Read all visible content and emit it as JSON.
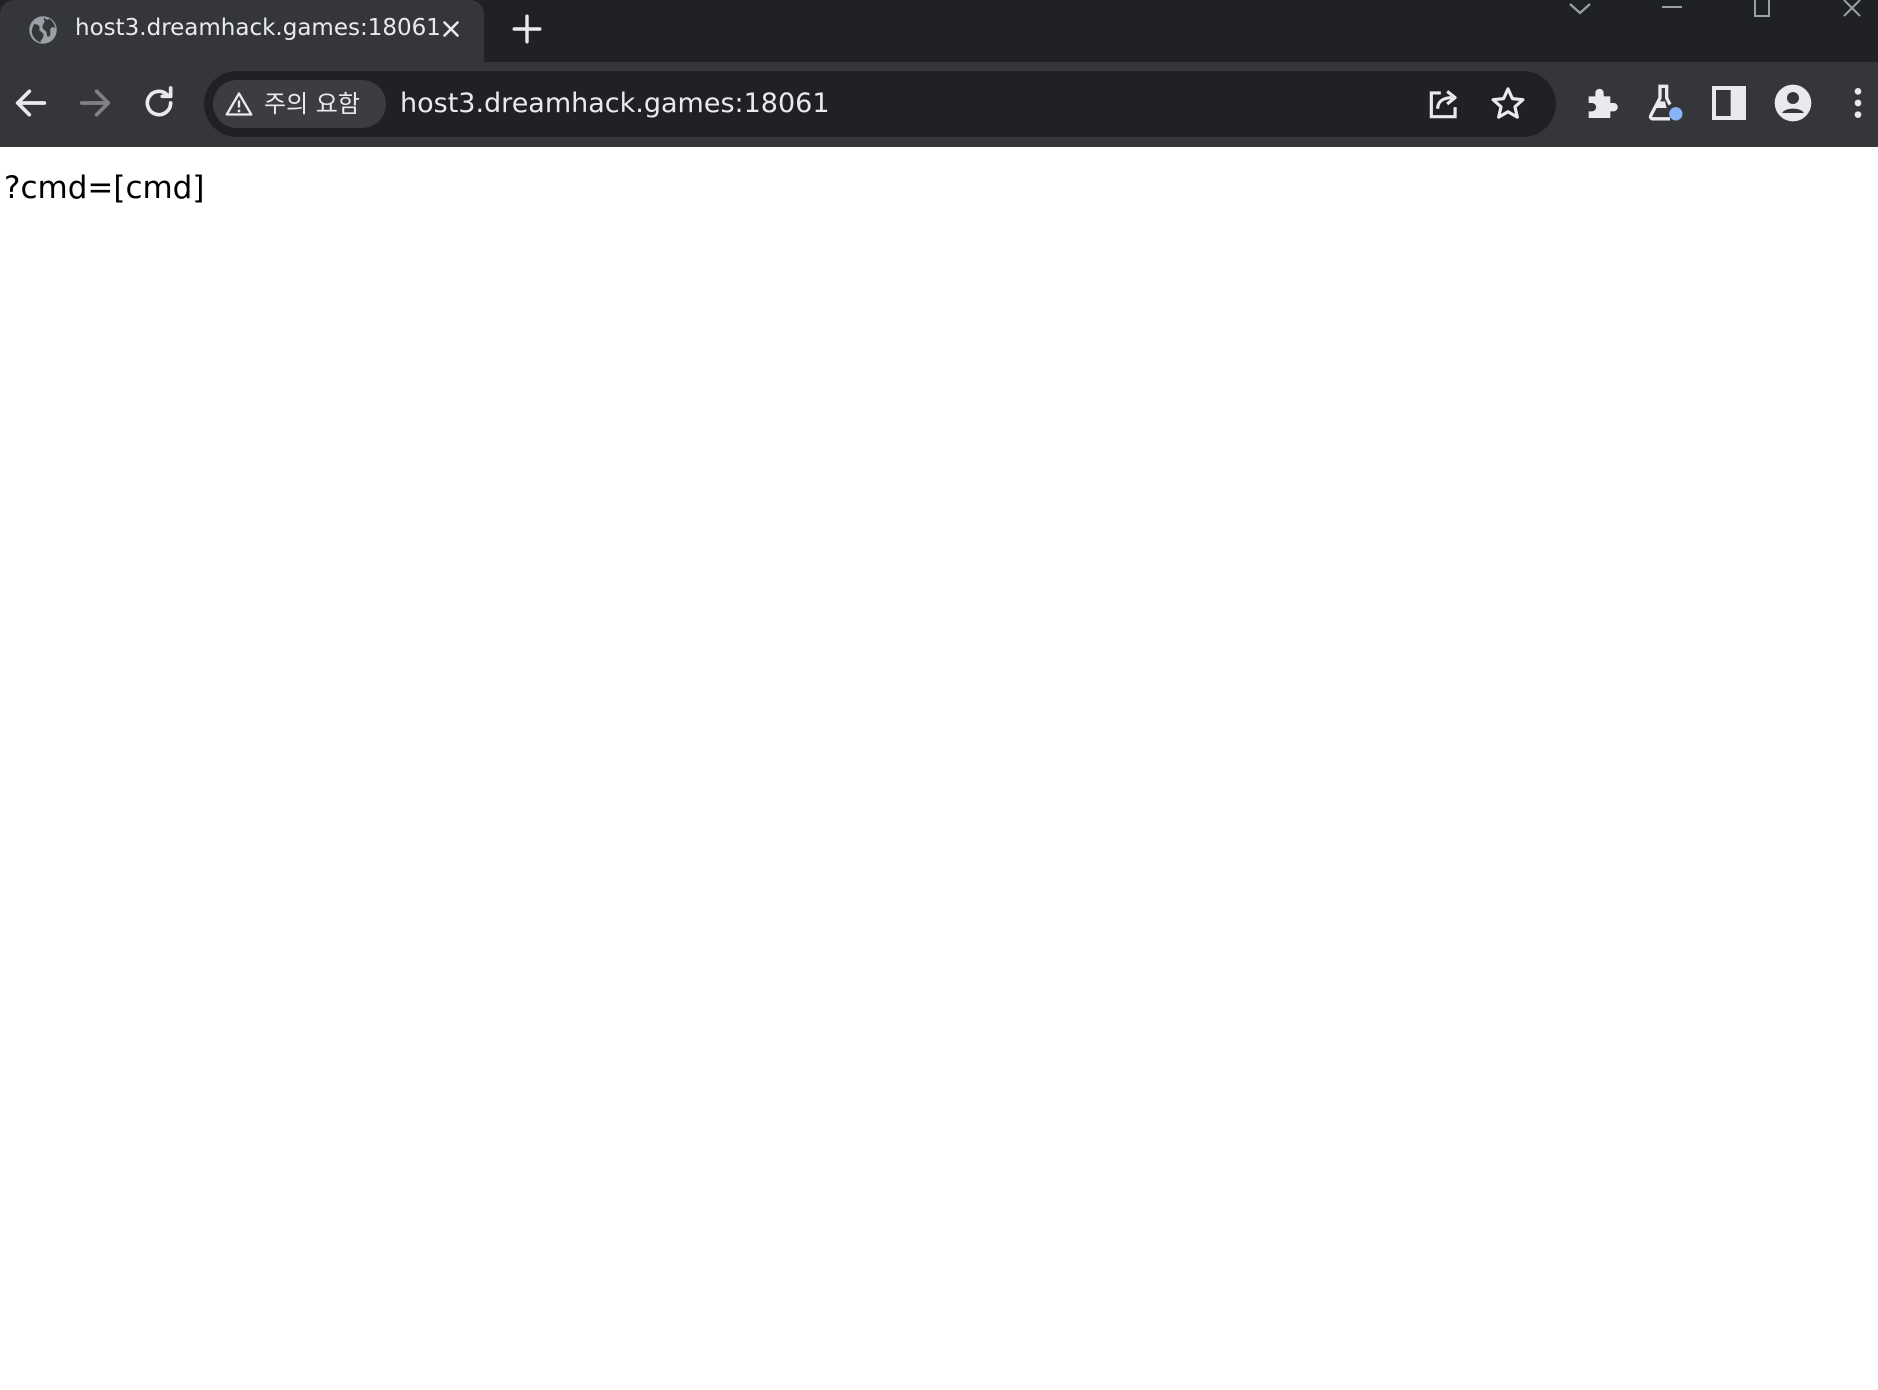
{
  "browser": {
    "tab": {
      "title": "host3.dreamhack.games:18061",
      "favicon": "globe-icon"
    },
    "toolbar": {
      "security_chip_label": "주의 요함",
      "url": "host3.dreamhack.games:18061"
    },
    "colors": {
      "tabstrip_bg": "#202124",
      "toolbar_bg": "#35363a",
      "omnibox_bg": "#202124",
      "text": "#e8eaed",
      "profile_badge": "#8ab4f8"
    }
  },
  "page": {
    "body_text": "?cmd=[cmd]"
  }
}
